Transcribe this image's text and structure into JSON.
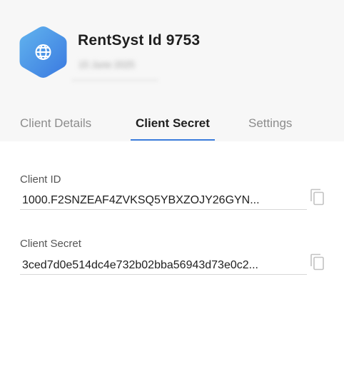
{
  "header": {
    "app_name": "RentSyst Id 9753",
    "app_subtitle": "15 June 2025",
    "icon": "globe-icon"
  },
  "tabs": [
    {
      "label": "Client Details",
      "active": false
    },
    {
      "label": "Client Secret",
      "active": true
    },
    {
      "label": "Settings",
      "active": false
    }
  ],
  "fields": {
    "client_id": {
      "label": "Client ID",
      "value": "1000.F2SNZEAF4ZVKSQ5YBXZOJY26GYN..."
    },
    "client_secret": {
      "label": "Client Secret",
      "value": "3ced7d0e514dc4e732b02bba56943d73e0c2..."
    }
  },
  "icons": {
    "copy": "copy-icon"
  },
  "colors": {
    "accent": "#3b7ddd",
    "icon_gradient_start": "#62b4ee",
    "icon_gradient_end": "#3a79e0",
    "header_bg": "#f7f7f7"
  }
}
